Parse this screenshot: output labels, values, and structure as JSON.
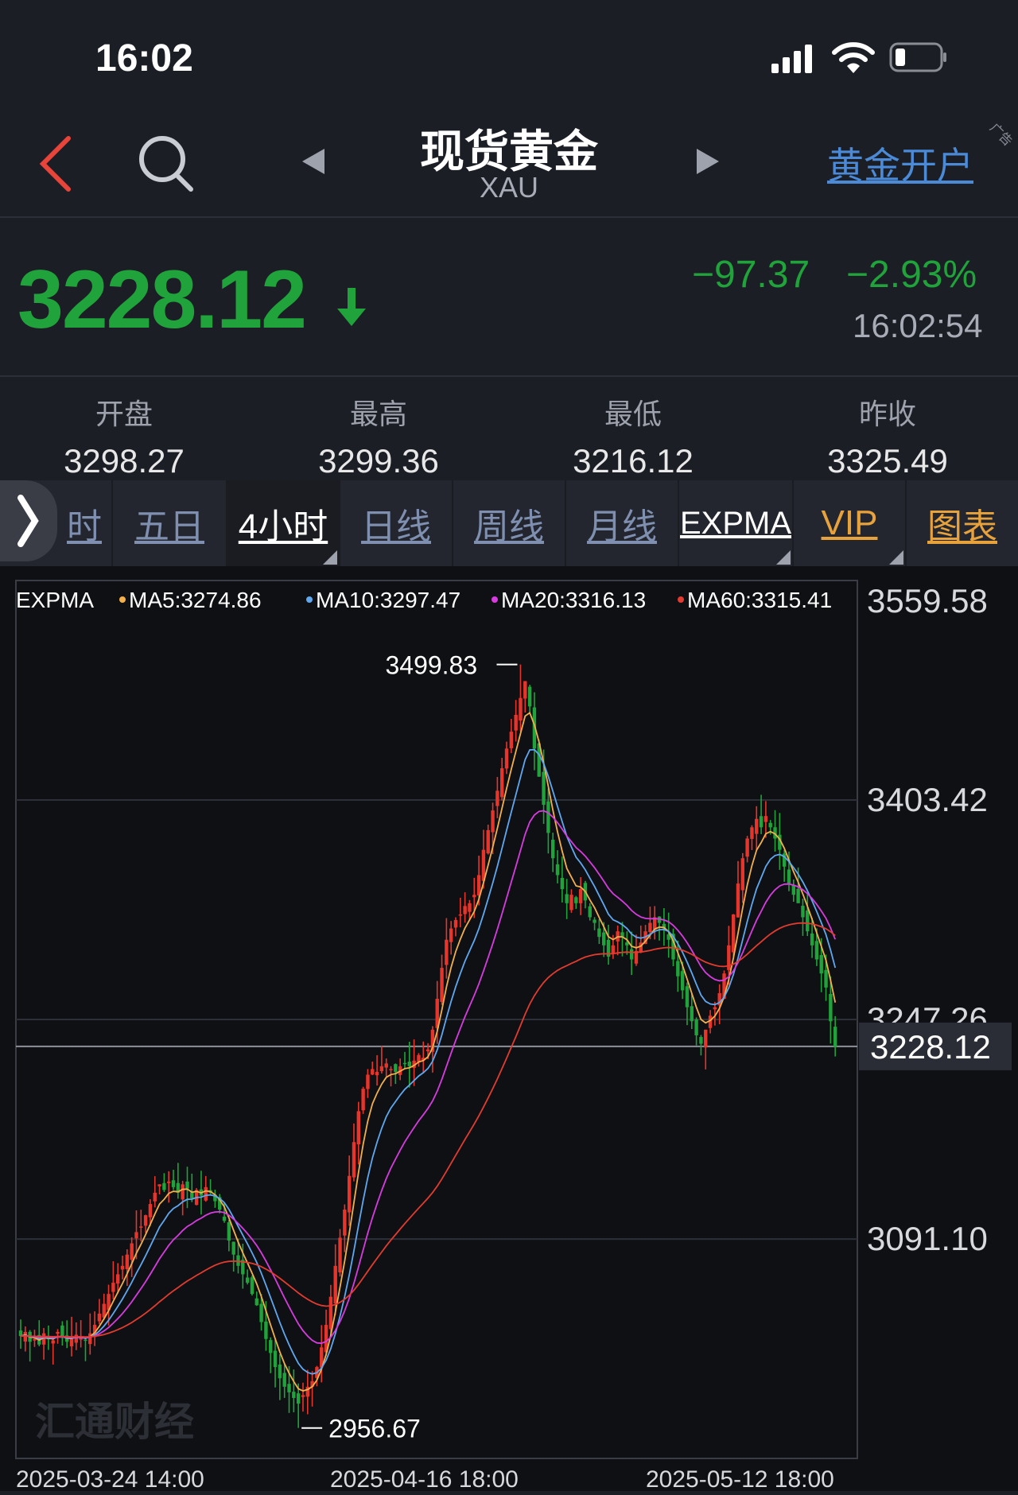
{
  "status": {
    "time": "16:02"
  },
  "header": {
    "title": "现货黄金",
    "subtitle": "XAU",
    "open_account": "黄金开户",
    "ad_tag": "广告"
  },
  "quote": {
    "price": "3228.12",
    "change": "−97.37",
    "change_pct": "−2.93%",
    "time": "16:02:54"
  },
  "stats": [
    {
      "label": "开盘",
      "value": "3298.27"
    },
    {
      "label": "最高",
      "value": "3299.36"
    },
    {
      "label": "最低",
      "value": "3216.12"
    },
    {
      "label": "昨收",
      "value": "3325.49"
    }
  ],
  "tabs": [
    "时",
    "五日",
    "4小时",
    "日线",
    "周线",
    "月线",
    "EXPMA",
    "VIP",
    "图表"
  ],
  "active_tab": "4小时",
  "colors": {
    "up": "#e8352b",
    "down": "#1fa33a",
    "ma5": "#f3b04a",
    "ma10": "#5fa8f0",
    "ma20": "#d83be0",
    "ma60": "#e23b2f",
    "vip": "#e7a23c"
  },
  "watermark": "汇通财经",
  "chart_data": {
    "type": "candlestick",
    "indicator_label": "EXPMA",
    "legend": [
      {
        "name": "MA5",
        "value": "3274.86",
        "color": "#f3b04a"
      },
      {
        "name": "MA10",
        "value": "3297.47",
        "color": "#5fa8f0"
      },
      {
        "name": "MA20",
        "value": "3316.13",
        "color": "#d83be0"
      },
      {
        "name": "MA60",
        "value": "3315.41",
        "color": "#e23b2f"
      }
    ],
    "y_ticks": [
      "3559.58",
      "3403.42",
      "3247.26",
      "3091.10"
    ],
    "ylim": [
      2935.0,
      3559.58
    ],
    "last_price": "3228.12",
    "high_label": "3499.83",
    "low_label": "2956.67",
    "x_ticks": [
      "2025-03-24 14:00",
      "2025-04-16 18:00",
      "2025-05-12 18:00"
    ],
    "close": [
      3022,
      3025,
      3018,
      3020,
      3016,
      3024,
      3020,
      3019,
      3025,
      3022,
      3018,
      3020,
      3023,
      3021,
      3019,
      3024,
      3030,
      3038,
      3045,
      3052,
      3060,
      3066,
      3072,
      3080,
      3088,
      3096,
      3100,
      3108,
      3116,
      3124,
      3130,
      3126,
      3132,
      3128,
      3124,
      3130,
      3127,
      3120,
      3126,
      3122,
      3128,
      3124,
      3118,
      3112,
      3104,
      3090,
      3080,
      3072,
      3066,
      3060,
      3052,
      3044,
      3032,
      3020,
      3010,
      3000,
      2992,
      2986,
      2982,
      2978,
      2974,
      2980,
      2986,
      2990,
      3000,
      3014,
      3030,
      3050,
      3072,
      3092,
      3112,
      3136,
      3160,
      3182,
      3198,
      3208,
      3212,
      3210,
      3214,
      3216,
      3212,
      3210,
      3214,
      3216,
      3214,
      3218,
      3222,
      3220,
      3226,
      3240,
      3262,
      3284,
      3304,
      3312,
      3318,
      3322,
      3328,
      3330,
      3336,
      3350,
      3368,
      3382,
      3396,
      3410,
      3426,
      3440,
      3452,
      3464,
      3476,
      3488,
      3470,
      3440,
      3420,
      3400,
      3380,
      3362,
      3350,
      3340,
      3330,
      3336,
      3330,
      3340,
      3332,
      3320,
      3316,
      3306,
      3300,
      3292,
      3300,
      3310,
      3306,
      3300,
      3290,
      3296,
      3302,
      3310,
      3316,
      3320,
      3316,
      3312,
      3304,
      3290,
      3278,
      3268,
      3256,
      3246,
      3236,
      3230,
      3240,
      3250,
      3256,
      3266,
      3280,
      3300,
      3322,
      3344,
      3362,
      3376,
      3384,
      3390,
      3384,
      3392,
      3384,
      3376,
      3368,
      3356,
      3344,
      3336,
      3330,
      3320,
      3310,
      3300,
      3290,
      3280,
      3270,
      3246,
      3228
    ],
    "extents": {
      "max_index": 108,
      "min_index": 60
    }
  }
}
